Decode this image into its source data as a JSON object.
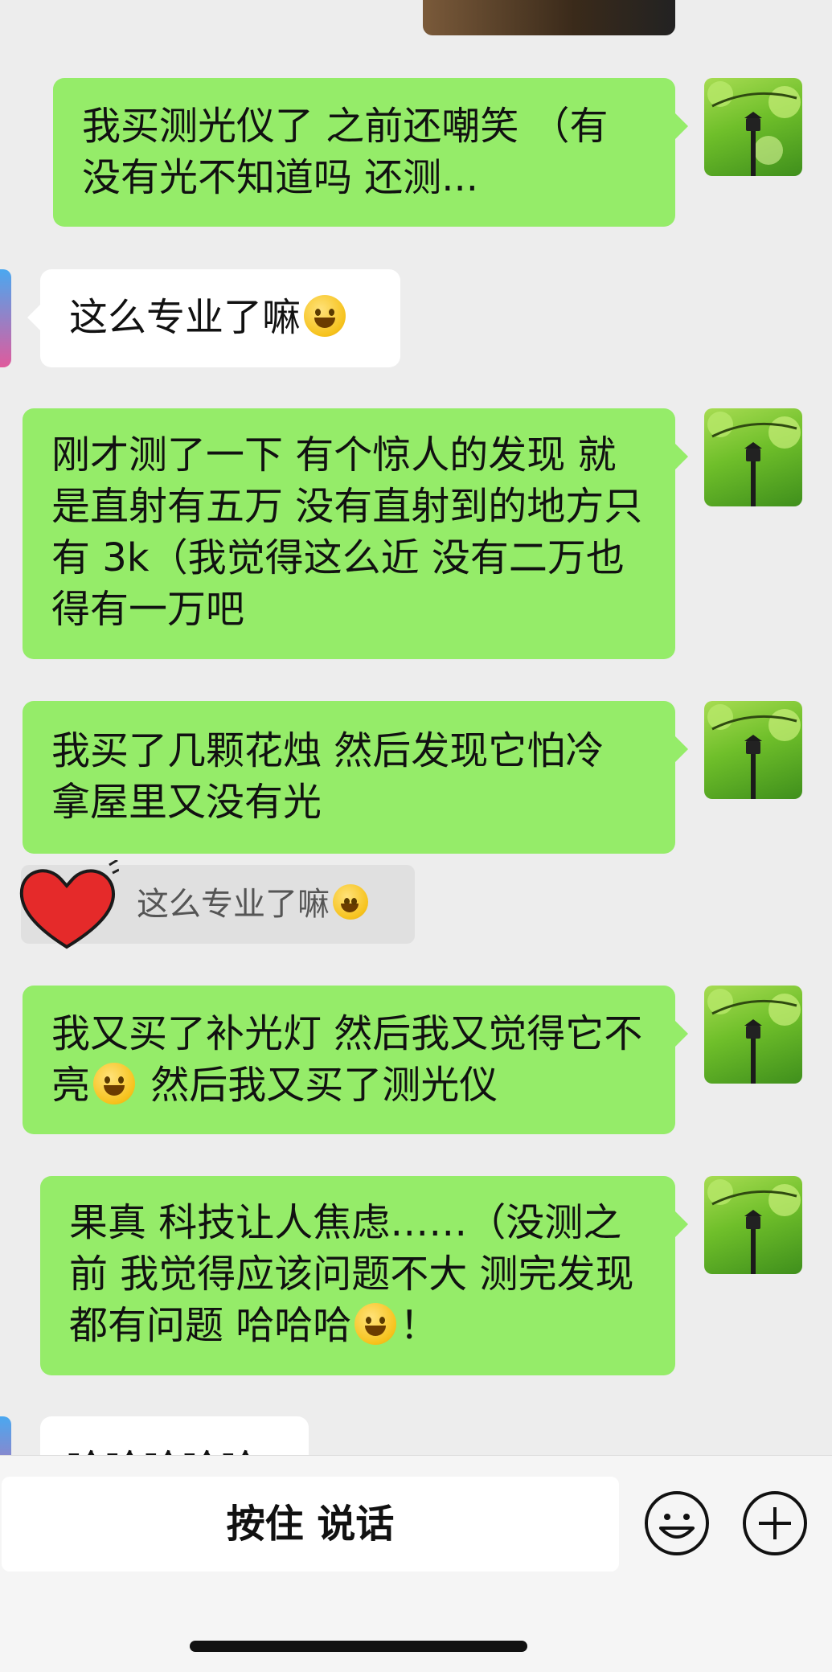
{
  "messages": [
    {
      "id": "m1",
      "side": "out",
      "text": "我买测光仪了 之前还嘲笑 （有没有光不知道吗 还测..."
    },
    {
      "id": "m2",
      "side": "in",
      "text": "这么专业了嘛"
    },
    {
      "id": "m3",
      "side": "out",
      "text": "刚才测了一下 有个惊人的发现 就是直射有五万 没有直射到的地方只有 3k（我觉得这么近 没有二万也得有一万吧"
    },
    {
      "id": "m4",
      "side": "out",
      "text": "我买了几颗花烛 然后发现它怕冷 拿屋里又没有光"
    },
    {
      "id": "m5",
      "side": "out",
      "text_before": "我又买了补光灯 然后我又觉得它不亮",
      "text_after": " 然后我又买了测光仪"
    },
    {
      "id": "m6",
      "side": "out",
      "text_before": "果真 科技让人焦虑……（没测之前 我觉得应该问题不大 测完发现都有问题 哈哈哈",
      "text_after": "！"
    },
    {
      "id": "m7",
      "side": "in",
      "text": "哈哈哈哈哈"
    }
  ],
  "quote": {
    "text": "这么专业了嘛"
  },
  "input_bar": {
    "talk_label": "按住 说话"
  },
  "icons": {
    "emoji": "smiley-face-icon",
    "plus": "plus-circle-icon"
  },
  "colors": {
    "outgoing_bubble": "#95ec69",
    "incoming_bubble": "#ffffff",
    "background": "#ededed"
  }
}
